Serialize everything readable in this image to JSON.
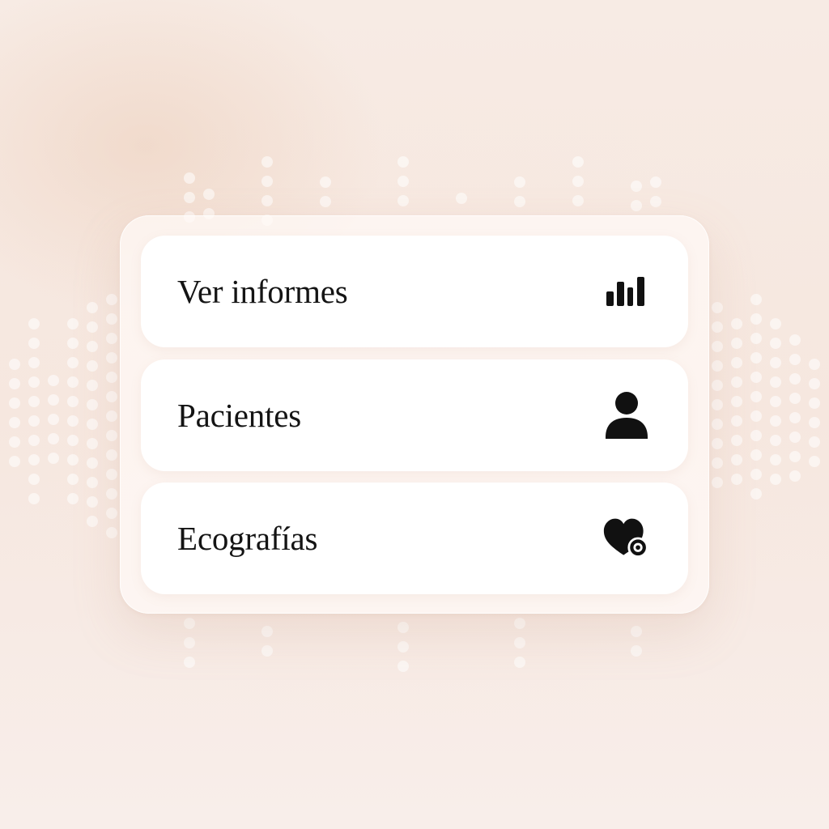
{
  "menu": {
    "items": [
      {
        "label": "Ver informes",
        "icon": "bar-chart-icon"
      },
      {
        "label": "Pacientes",
        "icon": "person-icon"
      },
      {
        "label": "Ecografías",
        "icon": "heart-monitor-icon"
      }
    ]
  },
  "colors": {
    "background": "#f6e7df",
    "card": "#ffffff",
    "text": "#141414",
    "icon": "#111111"
  }
}
